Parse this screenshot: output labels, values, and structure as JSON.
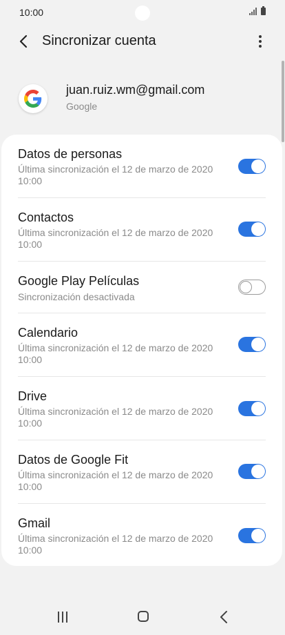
{
  "status": {
    "time": "10:00"
  },
  "header": {
    "title": "Sincronizar cuenta"
  },
  "account": {
    "email": "juan.ruiz.wm@gmail.com",
    "type": "Google"
  },
  "sync_items": [
    {
      "title": "Datos de personas",
      "subtitle": "Última sincronización el 12 de marzo de 2020 10:00",
      "enabled": true
    },
    {
      "title": "Contactos",
      "subtitle": "Última sincronización el 12 de marzo de 2020 10:00",
      "enabled": true
    },
    {
      "title": "Google Play Películas",
      "subtitle": "Sincronización desactivada",
      "enabled": false
    },
    {
      "title": "Calendario",
      "subtitle": "Última sincronización el 12 de marzo de 2020 10:00",
      "enabled": true
    },
    {
      "title": "Drive",
      "subtitle": "Última sincronización el 12 de marzo de 2020 10:00",
      "enabled": true
    },
    {
      "title": "Datos de Google Fit",
      "subtitle": "Última sincronización el 12 de marzo de 2020 10:00",
      "enabled": true
    },
    {
      "title": "Gmail",
      "subtitle": "Última sincronización el 12 de marzo de 2020 10:00",
      "enabled": true
    }
  ],
  "colors": {
    "accent": "#2a74e0",
    "background": "#f2f2f2"
  },
  "icons": {
    "back": "arrow-left-icon",
    "more": "more-vert-icon",
    "account": "google-logo-icon"
  }
}
